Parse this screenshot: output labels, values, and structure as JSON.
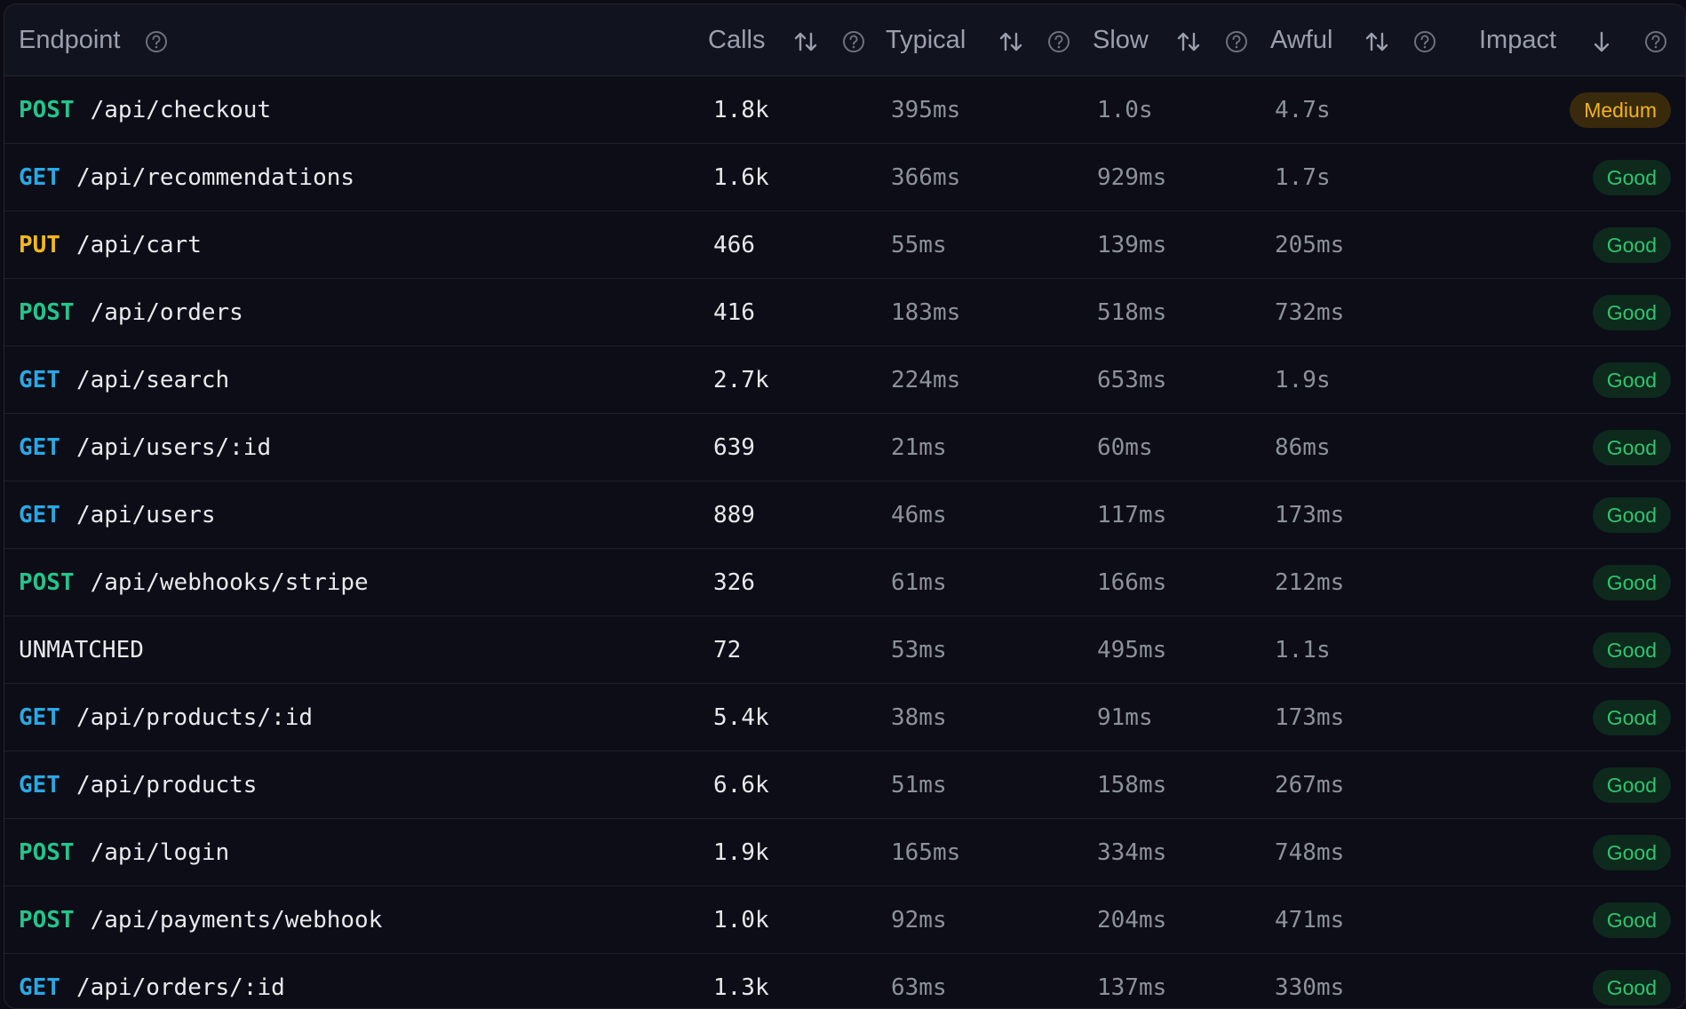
{
  "header": {
    "endpoint": "Endpoint",
    "calls": "Calls",
    "typical": "Typical",
    "slow": "Slow",
    "awful": "Awful",
    "impact": "Impact"
  },
  "colors": {
    "POST": "#22c58b",
    "GET": "#2aa8e6",
    "PUT": "#f3b81c",
    "good_text": "#30c46e",
    "good_bg": "#0d2a1d",
    "medium_text": "#f2b41f",
    "medium_bg": "#3a2a0c"
  },
  "rows": [
    {
      "method": "POST",
      "path": "/api/checkout",
      "calls": "1.8k",
      "typical": "395ms",
      "slow": "1.0s",
      "awful": "4.7s",
      "impact": "Medium"
    },
    {
      "method": "GET",
      "path": "/api/recommendations",
      "calls": "1.6k",
      "typical": "366ms",
      "slow": "929ms",
      "awful": "1.7s",
      "impact": "Good"
    },
    {
      "method": "PUT",
      "path": "/api/cart",
      "calls": "466",
      "typical": "55ms",
      "slow": "139ms",
      "awful": "205ms",
      "impact": "Good"
    },
    {
      "method": "POST",
      "path": "/api/orders",
      "calls": "416",
      "typical": "183ms",
      "slow": "518ms",
      "awful": "732ms",
      "impact": "Good"
    },
    {
      "method": "GET",
      "path": "/api/search",
      "calls": "2.7k",
      "typical": "224ms",
      "slow": "653ms",
      "awful": "1.9s",
      "impact": "Good"
    },
    {
      "method": "GET",
      "path": "/api/users/:id",
      "calls": "639",
      "typical": "21ms",
      "slow": "60ms",
      "awful": "86ms",
      "impact": "Good"
    },
    {
      "method": "GET",
      "path": "/api/users",
      "calls": "889",
      "typical": "46ms",
      "slow": "117ms",
      "awful": "173ms",
      "impact": "Good"
    },
    {
      "method": "POST",
      "path": "/api/webhooks/stripe",
      "calls": "326",
      "typical": "61ms",
      "slow": "166ms",
      "awful": "212ms",
      "impact": "Good"
    },
    {
      "method": "",
      "path": "UNMATCHED",
      "calls": "72",
      "typical": "53ms",
      "slow": "495ms",
      "awful": "1.1s",
      "impact": "Good"
    },
    {
      "method": "GET",
      "path": "/api/products/:id",
      "calls": "5.4k",
      "typical": "38ms",
      "slow": "91ms",
      "awful": "173ms",
      "impact": "Good"
    },
    {
      "method": "GET",
      "path": "/api/products",
      "calls": "6.6k",
      "typical": "51ms",
      "slow": "158ms",
      "awful": "267ms",
      "impact": "Good"
    },
    {
      "method": "POST",
      "path": "/api/login",
      "calls": "1.9k",
      "typical": "165ms",
      "slow": "334ms",
      "awful": "748ms",
      "impact": "Good"
    },
    {
      "method": "POST",
      "path": "/api/payments/webhook",
      "calls": "1.0k",
      "typical": "92ms",
      "slow": "204ms",
      "awful": "471ms",
      "impact": "Good"
    },
    {
      "method": "GET",
      "path": "/api/orders/:id",
      "calls": "1.3k",
      "typical": "63ms",
      "slow": "137ms",
      "awful": "330ms",
      "impact": "Good"
    }
  ]
}
